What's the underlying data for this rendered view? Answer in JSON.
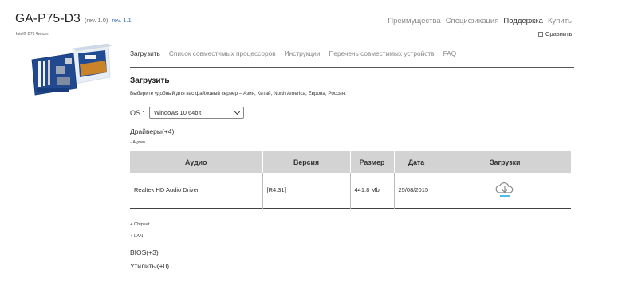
{
  "header": {
    "model": "GA-P75-D3",
    "rev_current": "(rev. 1.0)",
    "rev_link": "rev. 1.1",
    "chipset": "Intel® B75 Чипсет"
  },
  "topnav": {
    "items": [
      "Преимущества",
      "Спецификация",
      "Поддержка",
      "Купить"
    ],
    "active": "Поддержка"
  },
  "compare_label": "Сравнить",
  "tabs": {
    "items": [
      "Загрузить",
      "Список совместимых процессоров",
      "Инструкции",
      "Перечень совместимых устройств",
      "FAQ"
    ],
    "active": "Загрузить"
  },
  "download": {
    "title": "Загрузить",
    "hint": "Выберите удобный для вас файловый сервер – Азия, Китай, North America, Европа, Россия.",
    "os_label": "OS :",
    "os_value": "Windows 10 64bit",
    "drivers_head": "Драйверы(+4)",
    "audio_sub": "- Аудио",
    "table": {
      "headers": [
        "Аудио",
        "Версия",
        "Размер",
        "Дата",
        "Загрузки"
      ],
      "rows": [
        {
          "name": "Realtek HD Audio Driver",
          "version": "[R4.31]",
          "size": "441.8 Mb",
          "date": "25/08/2015",
          "icon": "cloud-download-icon"
        }
      ]
    },
    "collapsed": [
      "+ Chipset",
      "+ LAN"
    ],
    "categories": [
      "BIOS(+3)",
      "Утилиты(+0)"
    ]
  },
  "colors": {
    "link": "#3a6fb0",
    "table_header": "#d3d3d3",
    "icon": "#888888",
    "icon_accent": "#29a8e0"
  }
}
